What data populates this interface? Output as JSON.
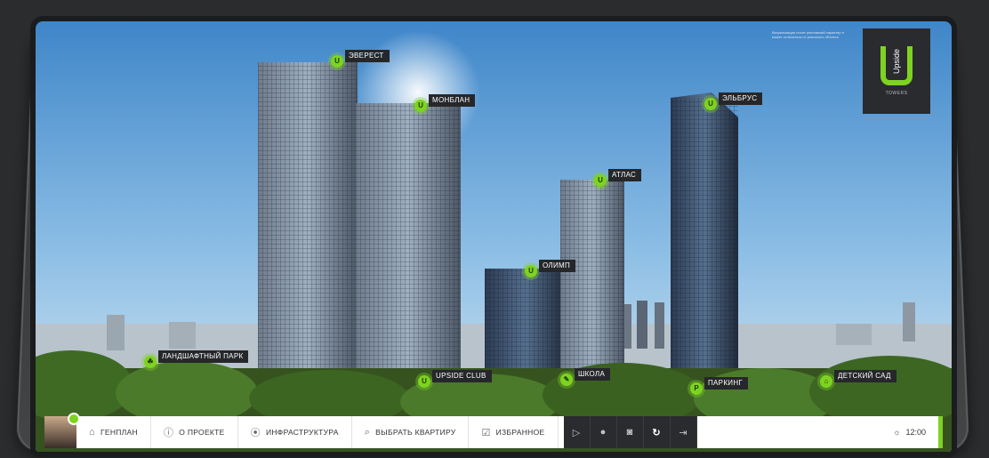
{
  "brand": {
    "name": "Upside",
    "sub": "TOWERS",
    "accent_color": "#7ed321"
  },
  "notice": "Визуализация носит рекламный характер и может отличаться от реального объекта",
  "markers": {
    "everest": "ЭВЕРЕСТ",
    "monblan": "МОНБЛАН",
    "elbrus": "ЭЛЬБРУС",
    "atlas": "АТЛАС",
    "olimp": "ОЛИМП",
    "landscape_park": "ЛАНДШАФТНЫЙ ПАРК",
    "upside_club": "UPSIDE CLUB",
    "school": "ШКОЛА",
    "parking": "ПАРКИНГ",
    "kindergarten": "ДЕТСКИЙ САД"
  },
  "toolbar": {
    "genplan": "ГЕНПЛАН",
    "about": "О ПРОЕКТЕ",
    "infrastructure": "ИНФРАСТРУКТУРА",
    "choose_apartment": "ВЫБРАТЬ КВАРТИРУ",
    "favorites": "ИЗБРАННОЕ",
    "time": "12:00"
  },
  "icons": {
    "genplan": "building-icon",
    "about": "info-icon",
    "infrastructure": "location-pin-icon",
    "choose_apartment": "search-icon",
    "favorites": "favorites-icon",
    "play": "play-icon",
    "record": "record-icon",
    "camera": "camera-icon",
    "refresh": "refresh-icon",
    "exit": "exit-icon",
    "weather": "sun-icon"
  }
}
